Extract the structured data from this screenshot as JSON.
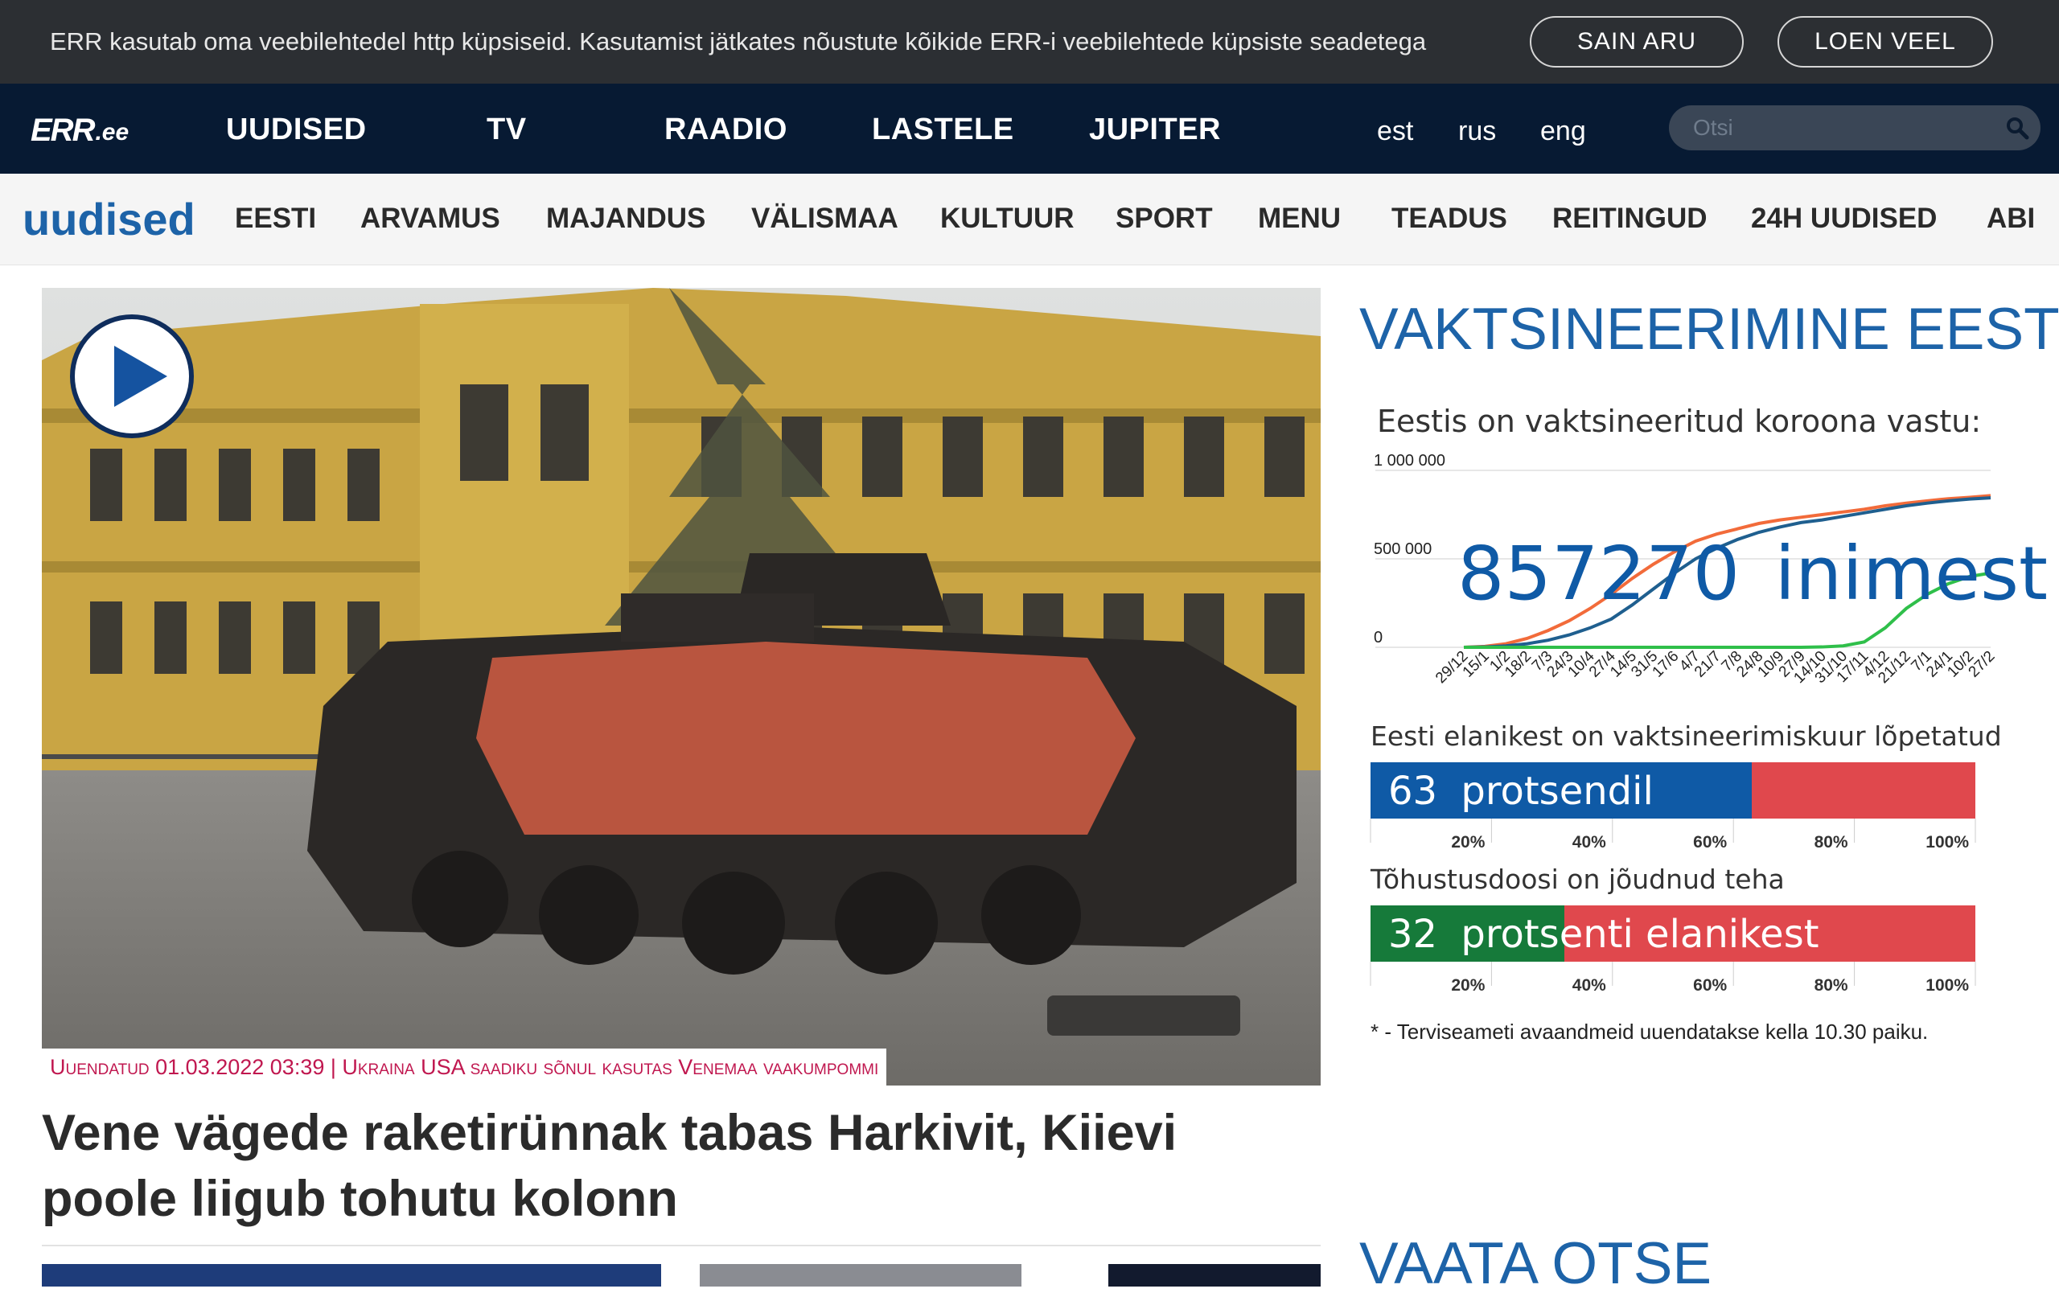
{
  "cookie": {
    "text": "ERR kasutab oma veebilehtedel http küpsiseid. Kasutamist jätkates nõustute kõikide ERR-i veebilehtede küpsiste seadetega",
    "accept_label": "SAIN ARU",
    "more_label": "LOEN VEEL"
  },
  "brand": {
    "logo": "ERR",
    "domain": ".ee"
  },
  "main_nav": [
    "UUDISED",
    "TV",
    "RAADIO",
    "LASTELE",
    "JUPITER"
  ],
  "languages": [
    "est",
    "rus",
    "eng"
  ],
  "search": {
    "placeholder": "Otsi",
    "value": ""
  },
  "section": {
    "title": "uudised",
    "items": [
      "EESTI",
      "ARVAMUS",
      "MAJANDUS",
      "VÄLISMAA",
      "KULTUUR",
      "SPORT",
      "MENU",
      "TEADUS",
      "REITINGUD",
      "24H UUDISED",
      "ABI"
    ]
  },
  "hero": {
    "caption": "Uuendatud 01.03.2022 03:39 | Ukraina USA saadiku sõnul kasutas Venemaa vaakumpommi",
    "headline": "Vene vägede raketirünnak tabas Harkivit, Kiievi poole liigub tohutu kolonn"
  },
  "vaccination": {
    "title": "VAKTSINEERIMINE EESTIS",
    "chart_title": "Eestis on vaktsineeritud koroona vastu:",
    "count": "857270",
    "count_unit": "inimest",
    "completed_label": "Eesti elanikest on vaktsineerimiskuur lõpetatud",
    "completed_value": "63",
    "completed_unit": "protsendil",
    "booster_label": "Tõhustusdoosi on jõudnud teha",
    "booster_value": "32",
    "booster_unit": "protsenti elanikest",
    "note": "* - Terviseameti avaandmeid uuendatakse kella 10.30 paiku.",
    "colors": {
      "series_a": "#f26b3a",
      "series_b": "#1f5f8f",
      "series_c": "#2fbf4a",
      "completed": "#0f5aa6",
      "booster": "#167a3a",
      "bar_bg": "#e0484d"
    }
  },
  "chart_data": [
    {
      "type": "line",
      "title": "Eestis on vaktsineeritud koroona vastu:",
      "yticks": [
        "1 000 000",
        "500 000",
        "0"
      ],
      "ylim": [
        0,
        1000000
      ],
      "categories": [
        "29/12",
        "15/1",
        "1/2",
        "18/2",
        "7/3",
        "24/3",
        "10/4",
        "27/4",
        "14/5",
        "31/5",
        "17/6",
        "4/7",
        "21/7",
        "7/8",
        "24/8",
        "10/9",
        "27/9",
        "14/10",
        "31/10",
        "17/11",
        "4/12",
        "21/12",
        "7/1",
        "24/1",
        "10/2",
        "27/2"
      ],
      "series": [
        {
          "values": [
            0,
            5000,
            20000,
            50000,
            95000,
            150000,
            220000,
            300000,
            390000,
            470000,
            540000,
            600000,
            640000,
            670000,
            700000,
            720000,
            735000,
            750000,
            765000,
            780000,
            800000,
            815000,
            828000,
            840000,
            848000,
            857270
          ]
        },
        {
          "values": [
            0,
            2000,
            8000,
            20000,
            40000,
            70000,
            110000,
            160000,
            240000,
            330000,
            420000,
            500000,
            560000,
            610000,
            650000,
            680000,
            705000,
            720000,
            740000,
            760000,
            780000,
            800000,
            815000,
            828000,
            838000,
            845000
          ]
        },
        {
          "values": [
            0,
            0,
            0,
            0,
            0,
            0,
            0,
            0,
            0,
            0,
            0,
            0,
            0,
            0,
            0,
            0,
            0,
            2000,
            8000,
            30000,
            110000,
            220000,
            300000,
            360000,
            400000,
            420000
          ]
        }
      ]
    },
    {
      "type": "bar",
      "title": "Eesti elanikest on vaktsineerimiskuur lõpetatud",
      "values": [
        63
      ],
      "xticks": [
        "20%",
        "40%",
        "60%",
        "80%",
        "100%"
      ],
      "xlim": [
        0,
        100
      ]
    },
    {
      "type": "bar",
      "title": "Tõhustusdoosi on jõudnud teha",
      "values": [
        32
      ],
      "xticks": [
        "20%",
        "40%",
        "60%",
        "80%",
        "100%"
      ],
      "xlim": [
        0,
        100
      ]
    }
  ],
  "live": {
    "title": "VAATA OTSE"
  },
  "icons": {
    "play": "play-icon",
    "search": "search-icon"
  }
}
